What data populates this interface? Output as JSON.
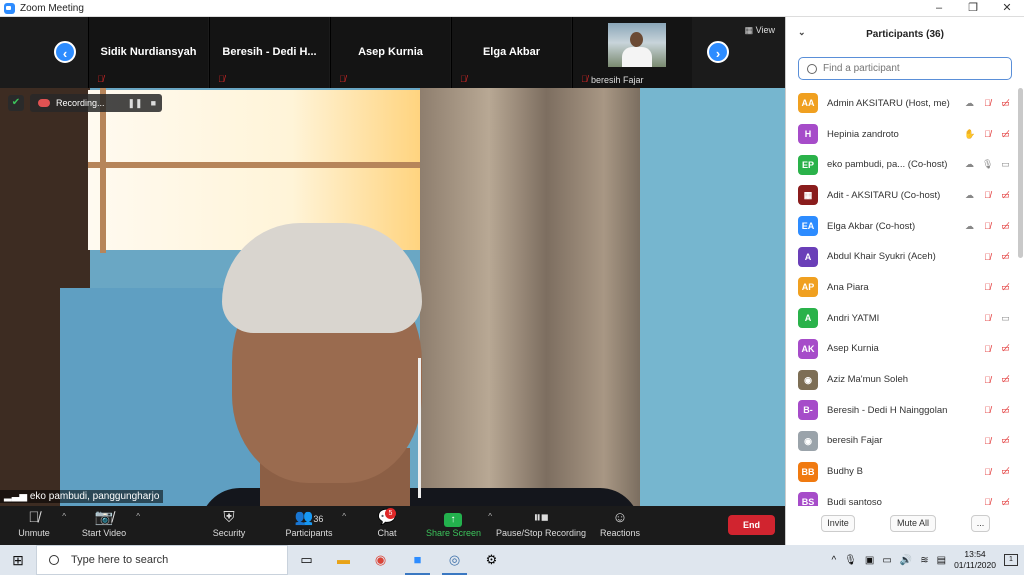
{
  "window": {
    "title": "Zoom Meeting",
    "controls": [
      "–",
      "❐",
      "✕"
    ]
  },
  "thumbnails": [
    {
      "name": "Sidik Nurdiansyah"
    },
    {
      "name": "Beresih - Dedi H..."
    },
    {
      "name": "Asep Kurnia"
    },
    {
      "name": "Elga Akbar"
    }
  ],
  "video_thumb": {
    "caption": "beresih Fajar"
  },
  "view_label": "View",
  "recording": {
    "label": "Recording..."
  },
  "active_speaker": "eko pambudi, panggungharjo",
  "toolbar": {
    "unmute": "Unmute",
    "start_video": "Start Video",
    "security": "Security",
    "participants": "Participants",
    "participants_count": "36",
    "chat": "Chat",
    "chat_badge": "5",
    "share_screen": "Share Screen",
    "pause_recording": "Pause/Stop Recording",
    "reactions": "Reactions",
    "end": "End"
  },
  "panel": {
    "title": "Participants (36)",
    "search_placeholder": "Find a participant",
    "participants": [
      {
        "initials": "AA",
        "color": "#f0a020",
        "name": "Admin AKSITARU (Host, me)",
        "cloud": true,
        "mic": "muted",
        "video": "off"
      },
      {
        "initials": "H",
        "color": "#a64cc9",
        "name": "Hepinia zandroto",
        "hand": true,
        "mic": "muted",
        "video": "off"
      },
      {
        "initials": "EP",
        "color": "#2ab24a",
        "name": "eko pambudi, pa...   (Co-host)",
        "cloud": true,
        "mic": "on",
        "video": "on"
      },
      {
        "initials": "▦",
        "color": "#8a1c1c",
        "name": "Adit - AKSITARU (Co-host)",
        "cloud": true,
        "mic": "muted",
        "video": "off"
      },
      {
        "initials": "EA",
        "color": "#2d8cff",
        "name": "Elga Akbar (Co-host)",
        "cloud": true,
        "mic": "muted",
        "video": "off"
      },
      {
        "initials": "A",
        "color": "#6a3fb8",
        "name": "Abdul Khair Syukri (Aceh)",
        "mic": "muted",
        "video": "off"
      },
      {
        "initials": "AP",
        "color": "#f0a020",
        "name": "Ana Piara",
        "mic": "muted",
        "video": "off"
      },
      {
        "initials": "A",
        "color": "#2ab24a",
        "name": "Andri YATMI",
        "mic": "muted",
        "video": "on"
      },
      {
        "initials": "AK",
        "color": "#a64cc9",
        "name": "Asep Kurnia",
        "mic": "muted",
        "video": "off"
      },
      {
        "initials": "◉",
        "color": "#7d6e55",
        "name": "Aziz Ma'mun Soleh",
        "mic": "muted",
        "video": "off"
      },
      {
        "initials": "B-",
        "color": "#a64cc9",
        "name": "Beresih - Dedi H Nainggolan",
        "mic": "muted",
        "video": "off"
      },
      {
        "initials": "◉",
        "color": "#9aa3aa",
        "name": "beresih Fajar",
        "mic": "muted",
        "video": "off"
      },
      {
        "initials": "BB",
        "color": "#f07a10",
        "name": "Budhy B",
        "mic": "muted",
        "video": "off"
      },
      {
        "initials": "BS",
        "color": "#a64cc9",
        "name": "Budi santoso",
        "mic": "muted",
        "video": "off"
      }
    ],
    "invite": "Invite",
    "mute_all": "Mute All",
    "more": "..."
  },
  "taskbar": {
    "search_placeholder": "Type here to search",
    "time": "13:54",
    "date": "01/11/2020",
    "notif_count": "1"
  }
}
